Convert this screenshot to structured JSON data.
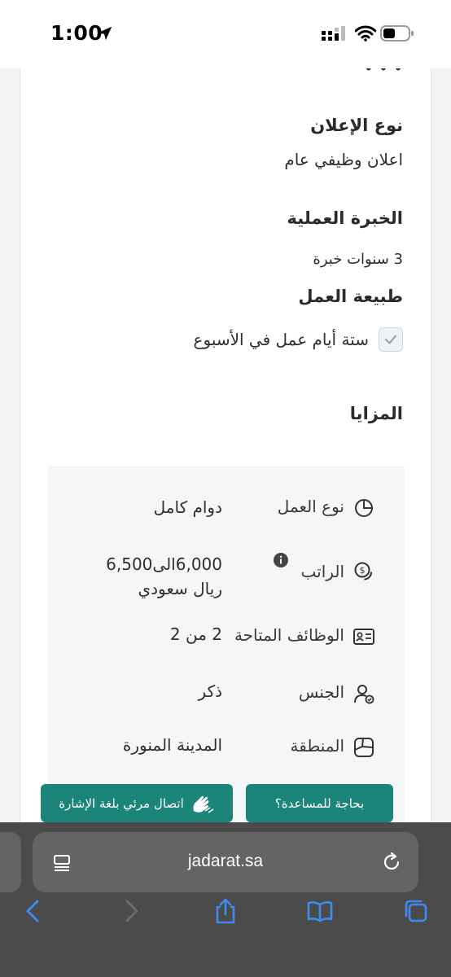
{
  "status_bar": {
    "time": "1:00"
  },
  "sections": {
    "ad_type": {
      "title": "نوع الإعلان",
      "value": "اعلان وظيفي عام"
    },
    "experience": {
      "title": "الخبرة العملية",
      "value": "3 سنوات خبرة"
    },
    "work_nature": {
      "title": "طبيعة العمل",
      "option": "ستة أيام عمل في الأسبوع",
      "checked": true
    },
    "benefits": {
      "title": "المزايا"
    }
  },
  "details": [
    {
      "label": "نوع العمل",
      "value": "دوام كامل",
      "icon": "pie-chart-icon"
    },
    {
      "label": "الراتب",
      "value": "6,000الى6,500 ريال سعودي",
      "icon": "salary-coin-icon"
    },
    {
      "label": "الوظائف المتاحة",
      "value": "2 من 2",
      "icon": "id-card-icon"
    },
    {
      "label": "الجنس",
      "value": "ذكر",
      "icon": "user-check-icon"
    },
    {
      "label": "المنطقة",
      "value": "المدينة المنورة",
      "icon": "map-region-icon"
    }
  ],
  "buttons": {
    "help": "بحاجة للمساعدة؟",
    "sign_language": "اتصال مرئي بلغة الإشارة"
  },
  "browser": {
    "url": "jadarat.sa"
  },
  "colors": {
    "accent": "#1b857a",
    "toolbar": "#4b4b4b",
    "toolbar_icon": "#3d8bf0"
  }
}
